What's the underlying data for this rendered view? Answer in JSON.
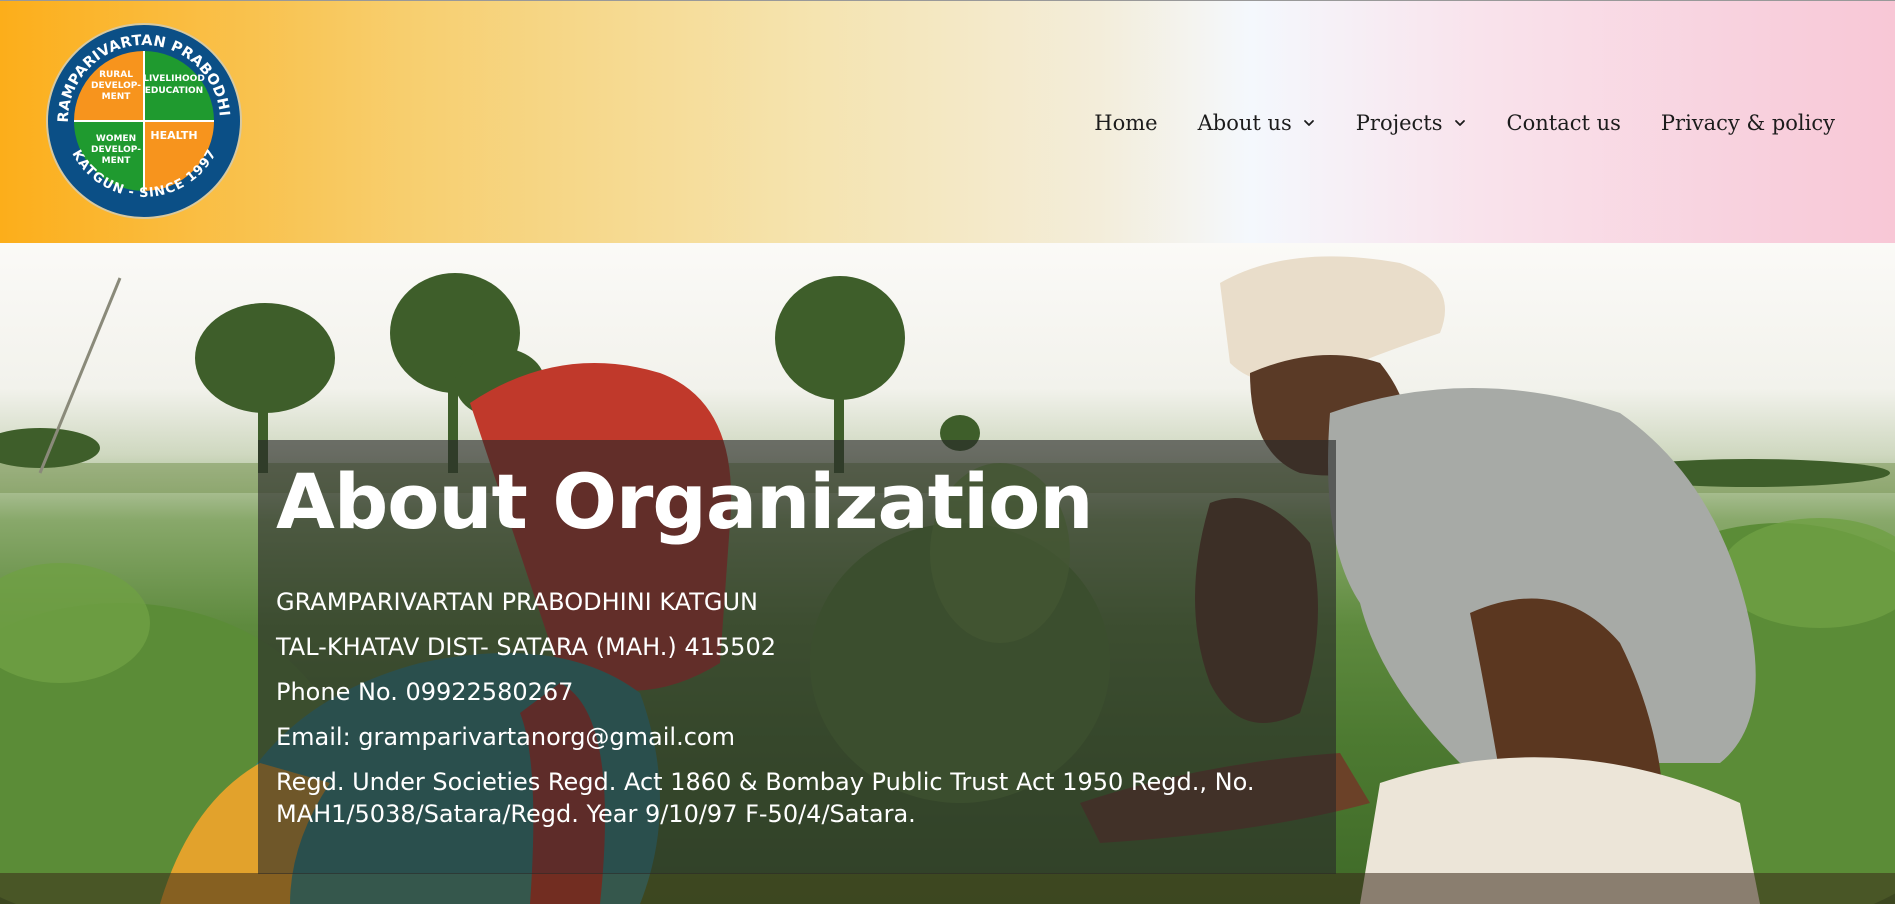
{
  "header": {
    "logo": {
      "ring_top_text": "GRAMPARIVARTAN PRABODHINI",
      "ring_bottom_text": "KATGUN - SINCE 1997",
      "quadrants": {
        "top_left": "RURAL DEVELOP- MENT",
        "top_right": "LIVELIHOOD EDUCATION",
        "bottom_left": "WOMEN DEVELOP- MENT",
        "bottom_right": "HEALTH"
      },
      "colors": {
        "ring": "#0b4f86",
        "orange": "#f7941d",
        "green": "#1f9a2f"
      }
    },
    "nav": {
      "home": "Home",
      "about": "About us",
      "projects": "Projects",
      "contact": "Contact us",
      "privacy": "Privacy & policy"
    }
  },
  "hero": {
    "title": "About Organization",
    "org_name": "GRAMPARIVARTAN PRABODHINI KATGUN",
    "address": "TAL-KHATAV DIST- SATARA (MAH.) 415502",
    "phone": "Phone No. 09922580267",
    "email": "Email: gramparivartanorg@gmail.com",
    "registration": "Regd. Under Societies Regd. Act 1860 & Bombay Public Trust Act 1950 Regd., No. MAH1/5038/Satara/Regd. Year 9/10/97 F-50/4/Satara."
  }
}
